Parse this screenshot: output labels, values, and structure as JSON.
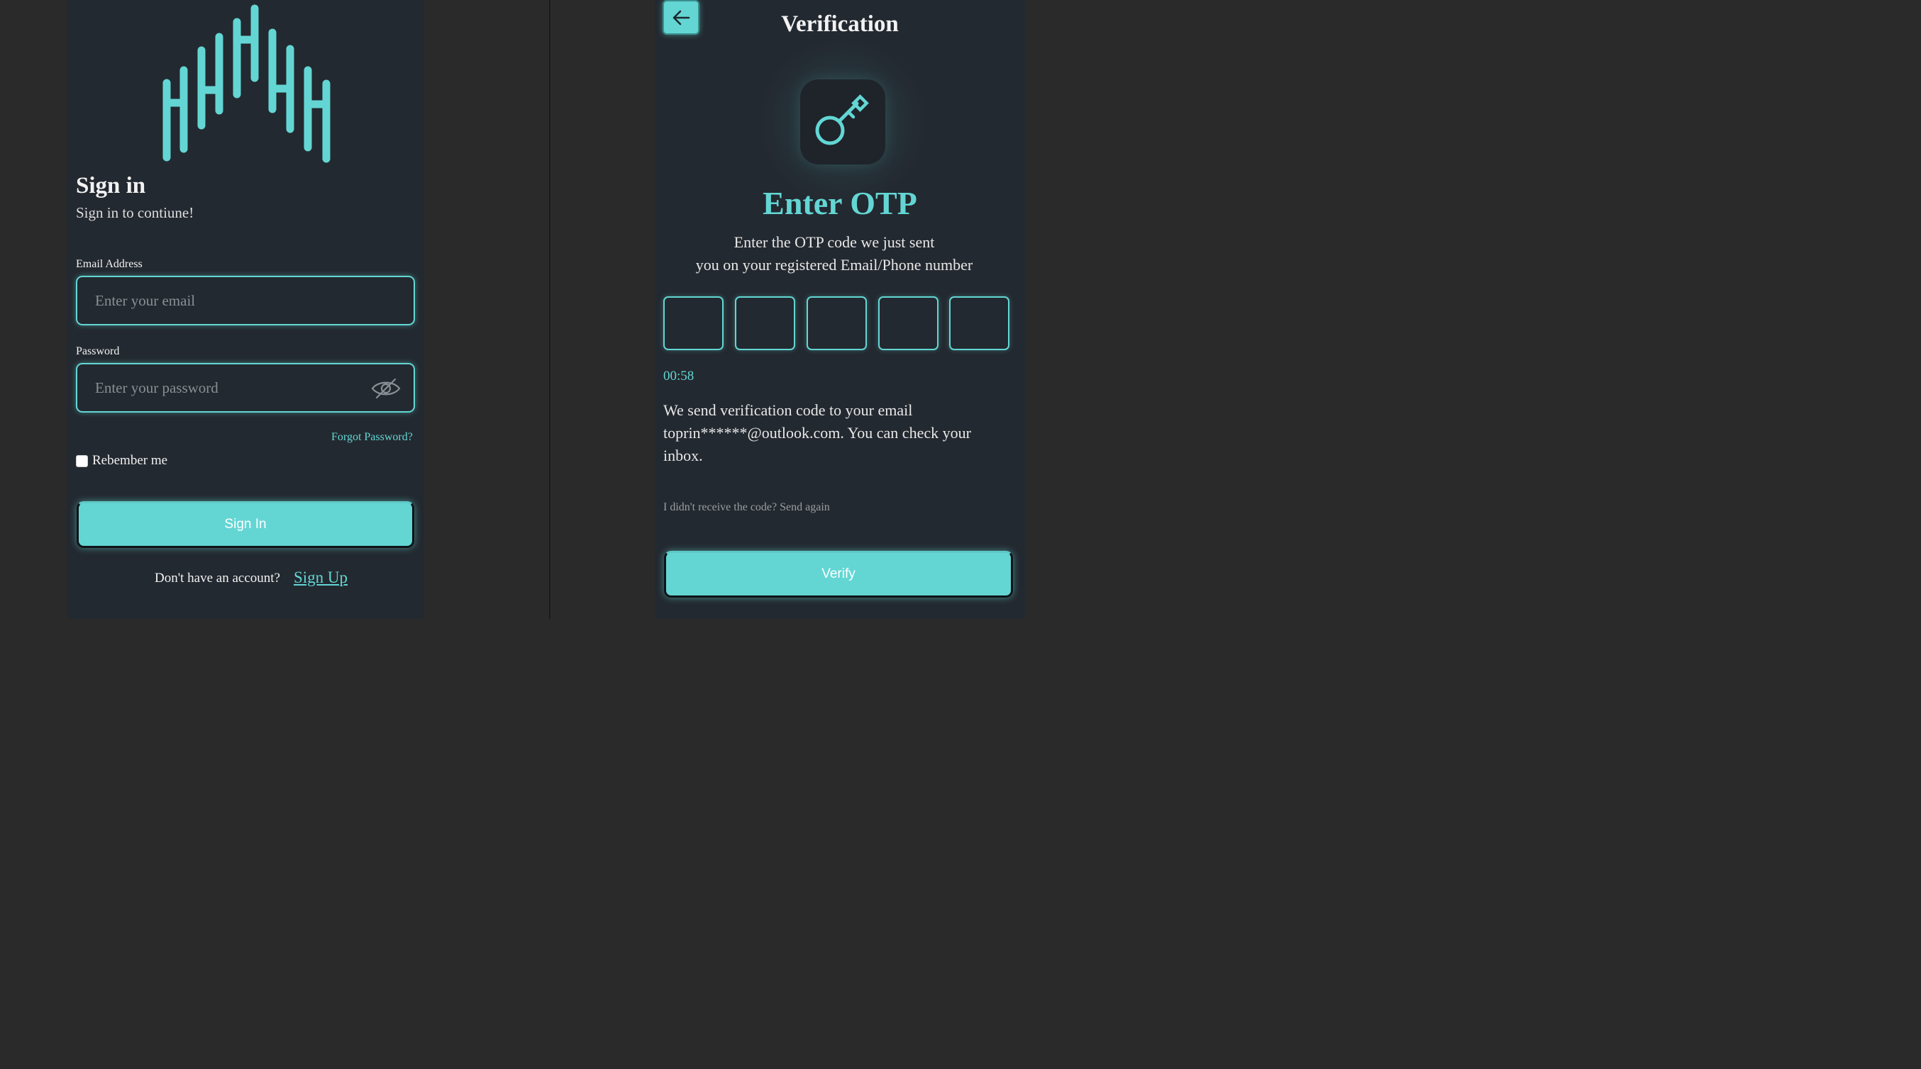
{
  "colors": {
    "accent": "#63d6d4",
    "panel": "#232930",
    "background": "#2a2a2b",
    "text": "#f2f2f2"
  },
  "signin": {
    "logo_icon": "waveform-logo",
    "title": "Sign in",
    "subtitle": "Sign in to contiune!",
    "email_label": "Email Address",
    "email_placeholder": "Enter your email",
    "email_value": "",
    "password_label": "Password",
    "password_placeholder": "Enter your password",
    "password_value": "",
    "password_toggle_icon": "eye-off-icon",
    "forgot_label": "Forgot Password?",
    "remember_label": "Rebember me",
    "remember_checked": false,
    "button_label": "Sign In",
    "no_account_text": "Don't have an account?",
    "signup_label": "Sign Up"
  },
  "verification": {
    "back_icon": "arrow-left-icon",
    "title": "Verification",
    "hero_icon": "key-icon",
    "heading": "Enter OTP",
    "desc_line1": "Enter the OTP code we just sent",
    "desc_line2": "you on your registered Email/Phone number",
    "otp_digits": [
      "",
      "",
      "",
      "",
      ""
    ],
    "timer": "00:58",
    "info_text": "We send verification code to your email toprin******@outlook.com. You can check your inbox.",
    "resend_text": "I didn't receive the code? Send again",
    "button_label": "Verify"
  }
}
